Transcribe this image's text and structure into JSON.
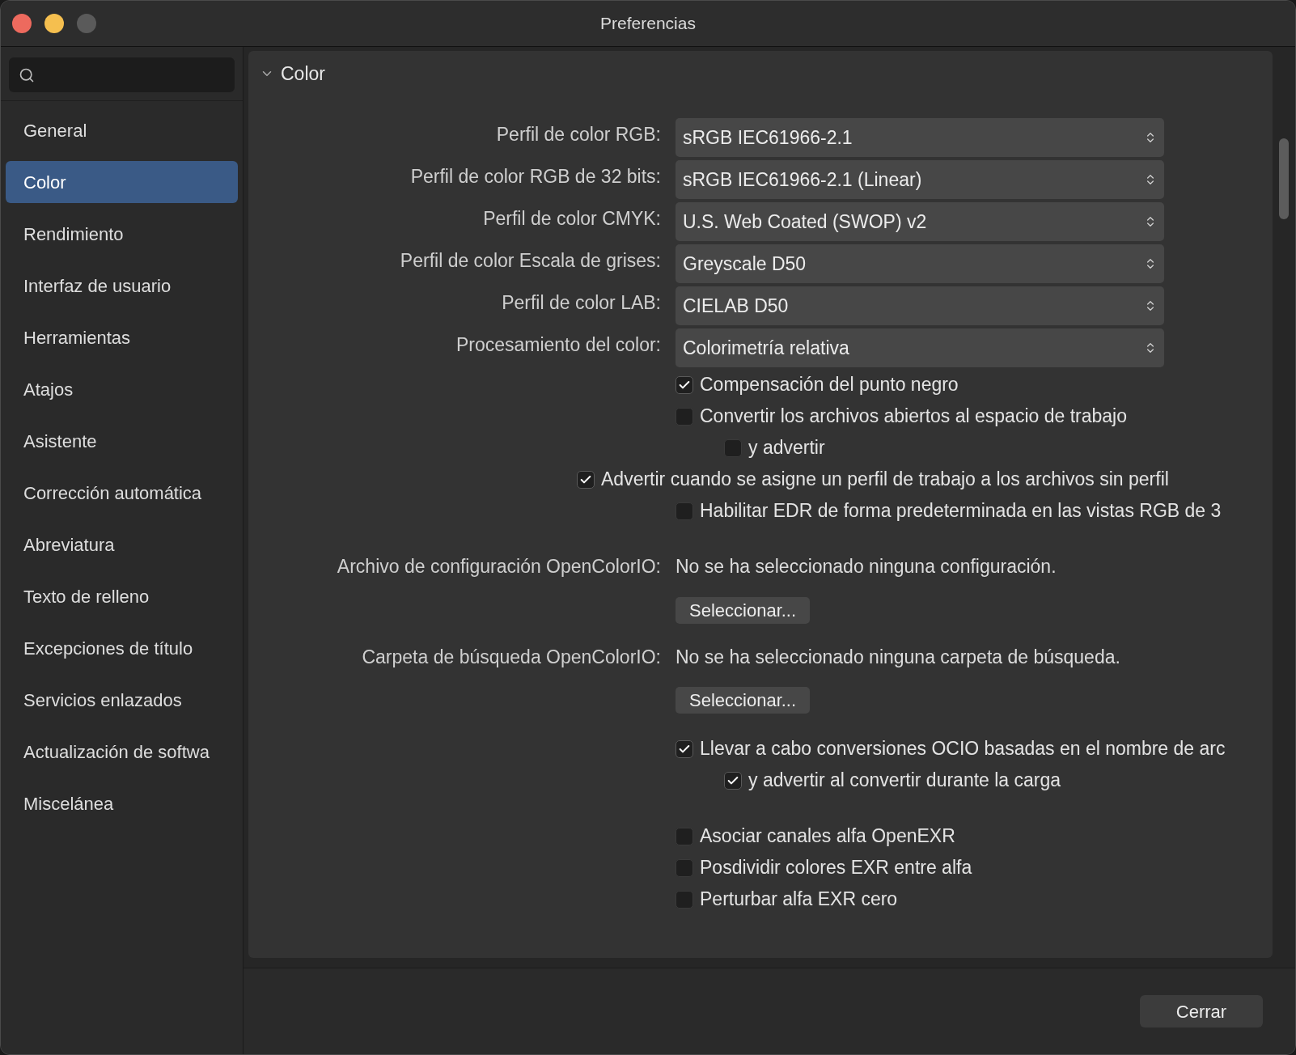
{
  "window": {
    "title": "Preferencias"
  },
  "sidebar": {
    "items": [
      {
        "label": "General",
        "selected": false
      },
      {
        "label": "Color",
        "selected": true
      },
      {
        "label": "Rendimiento",
        "selected": false
      },
      {
        "label": "Interfaz de usuario",
        "selected": false
      },
      {
        "label": "Herramientas",
        "selected": false
      },
      {
        "label": "Atajos",
        "selected": false
      },
      {
        "label": "Asistente",
        "selected": false
      },
      {
        "label": "Corrección automática",
        "selected": false
      },
      {
        "label": "Abreviatura",
        "selected": false
      },
      {
        "label": "Texto de relleno",
        "selected": false
      },
      {
        "label": "Excepciones de título",
        "selected": false
      },
      {
        "label": "Servicios enlazados",
        "selected": false
      },
      {
        "label": "Actualización de softwa",
        "selected": false
      },
      {
        "label": "Miscelánea",
        "selected": false
      }
    ]
  },
  "section": {
    "title": "Color",
    "expanded": true
  },
  "profiles": [
    {
      "label": "Perfil de color RGB:",
      "value": "sRGB IEC61966-2.1"
    },
    {
      "label": "Perfil de color RGB de 32 bits:",
      "value": "sRGB IEC61966-2.1 (Linear)"
    },
    {
      "label": "Perfil de color CMYK:",
      "value": "U.S. Web Coated (SWOP) v2"
    },
    {
      "label": "Perfil de color Escala de grises:",
      "value": "Greyscale D50"
    },
    {
      "label": "Perfil de color LAB:",
      "value": "CIELAB D50"
    },
    {
      "label": "Procesamiento del color:",
      "value": "Colorimetría relativa"
    }
  ],
  "color_options": [
    {
      "label": "Compensación del punto negro",
      "checked": true,
      "kind": "standard"
    },
    {
      "label": "Convertir los archivos abiertos al espacio de trabajo",
      "checked": false,
      "kind": "standard",
      "children": [
        {
          "label": "y advertir",
          "checked": false,
          "kind": "standard"
        }
      ]
    },
    {
      "label": "Advertir cuando se asigne un perfil de trabajo a los archivos sin perfil",
      "checked": true,
      "kind": "outdented"
    },
    {
      "label": "Habilitar EDR de forma predeterminada en las vistas RGB de 3",
      "checked": false,
      "kind": "standard"
    }
  ],
  "ocio": [
    {
      "label": "Archivo de configuración OpenColorIO:",
      "value": "No se ha seleccionado ninguna configuración.",
      "button": "Seleccionar..."
    },
    {
      "label": "Carpeta de búsqueda OpenColorIO:",
      "value": "No se ha seleccionado ninguna carpeta de búsqueda.",
      "button": "Seleccionar..."
    }
  ],
  "ocio_options": [
    {
      "label": "Llevar a cabo conversiones OCIO basadas en el nombre de arc",
      "checked": true,
      "kind": "standard",
      "children": [
        {
          "label": "y advertir al convertir durante la carga",
          "checked": true,
          "kind": "standard"
        }
      ]
    }
  ],
  "exr_options": [
    {
      "label": "Asociar canales alfa OpenEXR",
      "checked": false,
      "kind": "standard"
    },
    {
      "label": "Posdividir colores EXR entre alfa",
      "checked": false,
      "kind": "standard"
    },
    {
      "label": "Perturbar alfa EXR cero",
      "checked": false,
      "kind": "standard"
    }
  ],
  "footer": {
    "button": "Cerrar"
  }
}
